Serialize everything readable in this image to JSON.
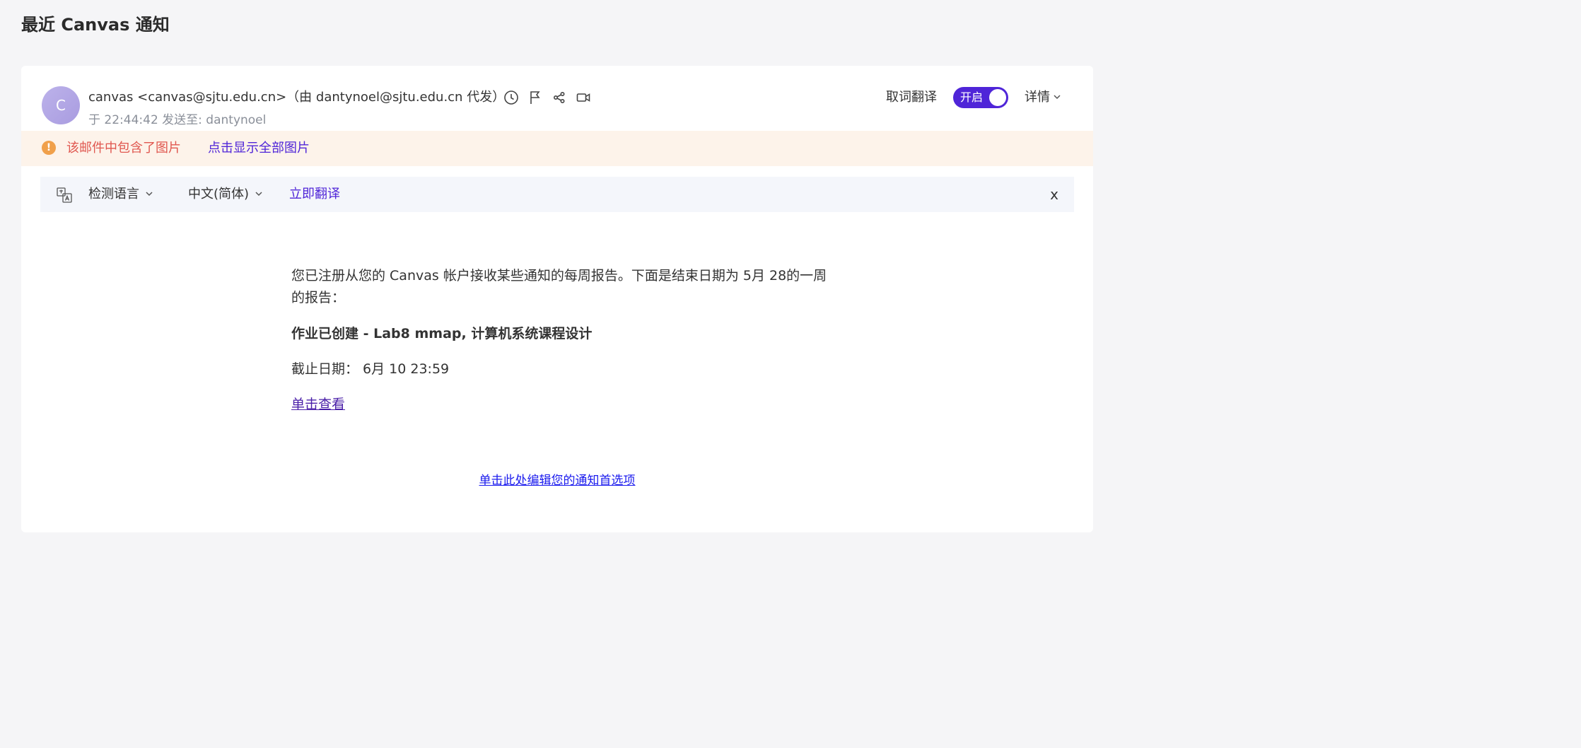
{
  "page": {
    "title": "最近 Canvas 通知"
  },
  "email": {
    "avatar_letter": "C",
    "sender": "canvas <canvas@sjtu.edu.cn>（由 dantynoel@sjtu.edu.cn 代发）",
    "meta": "于 22:44:42 发送至: dantynoel",
    "header_icons": [
      "clock-icon",
      "flag-icon",
      "share-icon",
      "video-icon"
    ],
    "translate_label": "取词翻译",
    "toggle_label": "开启",
    "toggle_on": true,
    "details_label": "详情"
  },
  "image_banner": {
    "warning": "该邮件中包含了图片",
    "show_link": "点击显示全部图片"
  },
  "translate_bar": {
    "source_lang": "检测语言",
    "target_lang": "中文(简体)",
    "translate_now": "立即翻译",
    "close": "x"
  },
  "content": {
    "intro": "您已注册从您的 Canvas 帐户接收某些通知的每周报告。下面是结束日期为 5月 28的一周的报告：",
    "assignment": "作业已创建 - Lab8 mmap, 计算机系统课程设计",
    "due": "截止日期： 6月 10 23:59",
    "view_link": "单击查看",
    "prefs_link": "单击此处编辑您的通知首选项"
  },
  "colors": {
    "accent": "#4f25d8",
    "warning_text": "#e0574f",
    "banner_bg": "#fdf3ea",
    "translate_bar_bg": "#f4f6fb"
  }
}
